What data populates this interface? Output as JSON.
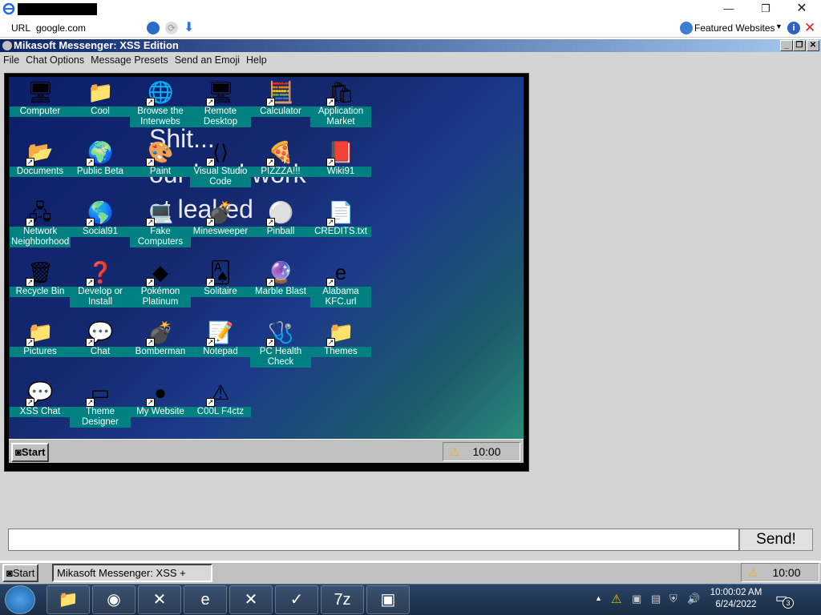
{
  "browser": {
    "url_label": "URL",
    "url_value": "google.com",
    "featured_label": "Featured Websites"
  },
  "messenger": {
    "title": "Mikasoft Messenger: XSS Edition",
    "menu": [
      "File",
      "Chat Options",
      "Message Presets",
      "Send an Emoji",
      "Help"
    ],
    "send_label": "Send!",
    "input_value": ""
  },
  "desktop": {
    "ghost_text": "Shit...\nour hard work\not leaked",
    "icons": [
      {
        "label": "Computer",
        "icon": "computer-icon",
        "glyph": "🖥"
      },
      {
        "label": "Cool",
        "icon": "folder-icon",
        "glyph": "📁"
      },
      {
        "label": "Browse the Interwebs",
        "icon": "ie-icon",
        "glyph": "🌐"
      },
      {
        "label": "Remote Desktop",
        "icon": "remote-desktop-icon",
        "glyph": "🖥"
      },
      {
        "label": "Calculator",
        "icon": "calculator-icon",
        "glyph": "🧮"
      },
      {
        "label": "Application Market",
        "icon": "shopping-bag-icon",
        "glyph": "🛍"
      },
      {
        "label": "Documents",
        "icon": "open-folder-icon",
        "glyph": "📂"
      },
      {
        "label": "Public Beta",
        "icon": "globe-icon",
        "glyph": "🌍"
      },
      {
        "label": "Paint",
        "icon": "paint-icon",
        "glyph": "🎨"
      },
      {
        "label": "Visual Studio Code",
        "icon": "vscode-icon",
        "glyph": "⟨⟩"
      },
      {
        "label": "PIZZZA!!!",
        "icon": "pizza-icon",
        "glyph": "🍕"
      },
      {
        "label": "Wiki91",
        "icon": "book-icon",
        "glyph": "📕"
      },
      {
        "label": "Network Neighborhood",
        "icon": "network-icon",
        "glyph": "🖧"
      },
      {
        "label": "Social91",
        "icon": "globe-icon",
        "glyph": "🌎"
      },
      {
        "label": "Fake Computers",
        "icon": "computers-icon",
        "glyph": "💻"
      },
      {
        "label": "Minesweeper",
        "icon": "mine-icon",
        "glyph": "💣"
      },
      {
        "label": "Pinball",
        "icon": "pinball-icon",
        "glyph": "⚪"
      },
      {
        "label": "CREDITS.txt",
        "icon": "text-file-icon",
        "glyph": "📄"
      },
      {
        "label": "Recycle Bin",
        "icon": "recycle-bin-icon",
        "glyph": "🗑"
      },
      {
        "label": "Develop or Install",
        "icon": "help-icon",
        "glyph": "❓"
      },
      {
        "label": "Pokémon Platinum",
        "icon": "pokemon-icon",
        "glyph": "◆"
      },
      {
        "label": "Solitaire",
        "icon": "cards-icon",
        "glyph": "🂡"
      },
      {
        "label": "Marble Blast",
        "icon": "marble-icon",
        "glyph": "🔮"
      },
      {
        "label": "Alabama KFC.url",
        "icon": "ie-shortcut-icon",
        "glyph": "e"
      },
      {
        "label": "Pictures",
        "icon": "folder-icon",
        "glyph": "📁"
      },
      {
        "label": "Chat",
        "icon": "chat-bubble-icon",
        "glyph": "💬"
      },
      {
        "label": "Bomberman",
        "icon": "bomberman-icon",
        "glyph": "💣"
      },
      {
        "label": "Notepad",
        "icon": "notepad-icon",
        "glyph": "📝"
      },
      {
        "label": "PC Health Check",
        "icon": "health-check-icon",
        "glyph": "🩺"
      },
      {
        "label": "Themes",
        "icon": "folder-icon",
        "glyph": "📁"
      },
      {
        "label": "XSS Chat",
        "icon": "chat-warning-icon",
        "glyph": "💬"
      },
      {
        "label": "Theme Designer",
        "icon": "window-icon",
        "glyph": "▭"
      },
      {
        "label": "My Website",
        "icon": "github-icon",
        "glyph": "●"
      },
      {
        "label": "C00L F4ctz",
        "icon": "fact-icon",
        "glyph": "⚠"
      }
    ],
    "start_label": "Start",
    "tray_time": "10:00"
  },
  "outer_taskbar": {
    "start_label": "Start",
    "task_label": "Mikasoft Messenger: XSS +",
    "tray_time": "10:00"
  },
  "win7": {
    "time": "10:00:02 AM",
    "date": "6/24/2022",
    "notification_count": "3",
    "apps": [
      {
        "name": "file-explorer",
        "glyph": "📁"
      },
      {
        "name": "chrome",
        "glyph": "◉"
      },
      {
        "name": "error-app",
        "glyph": "✕"
      },
      {
        "name": "ie",
        "glyph": "e"
      },
      {
        "name": "error-app-2",
        "glyph": "✕"
      },
      {
        "name": "checkmark-app",
        "glyph": "✓"
      },
      {
        "name": "7zip",
        "glyph": "7z"
      },
      {
        "name": "image-viewer",
        "glyph": "▣"
      }
    ]
  },
  "colors": {
    "title_start": "#0a246a",
    "icon_label_bg": "#008080",
    "desktop_bg": "#15296f"
  }
}
